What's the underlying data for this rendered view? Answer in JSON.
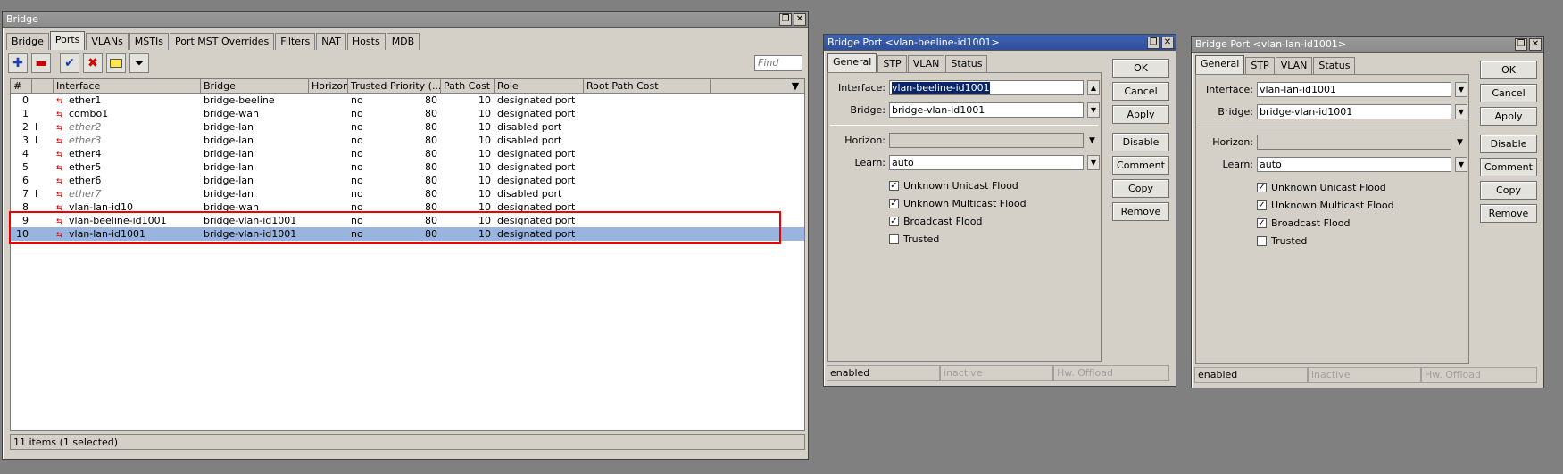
{
  "bridge_window": {
    "title": "Bridge",
    "tabs": [
      "Bridge",
      "Ports",
      "VLANs",
      "MSTIs",
      "Port MST Overrides",
      "Filters",
      "NAT",
      "Hosts",
      "MDB"
    ],
    "selected_tab": "Ports",
    "find_placeholder": "Find",
    "columns": [
      "#",
      "",
      "Interface",
      "Bridge",
      "Horizon",
      "Trusted",
      "Priority (...",
      "Path Cost",
      "Role",
      "Root Path Cost"
    ],
    "rows": [
      {
        "num": "0",
        "flag": "",
        "iface": "ether1",
        "bridge": "bridge-beeline",
        "horizon": "",
        "trusted": "no",
        "priority": "80",
        "cost": "10",
        "role": "designated port",
        "disabled": false
      },
      {
        "num": "1",
        "flag": "",
        "iface": "combo1",
        "bridge": "bridge-wan",
        "horizon": "",
        "trusted": "no",
        "priority": "80",
        "cost": "10",
        "role": "designated port",
        "disabled": false
      },
      {
        "num": "2",
        "flag": "I",
        "iface": "ether2",
        "bridge": "bridge-lan",
        "horizon": "",
        "trusted": "no",
        "priority": "80",
        "cost": "10",
        "role": "disabled port",
        "disabled": true
      },
      {
        "num": "3",
        "flag": "I",
        "iface": "ether3",
        "bridge": "bridge-lan",
        "horizon": "",
        "trusted": "no",
        "priority": "80",
        "cost": "10",
        "role": "disabled port",
        "disabled": true
      },
      {
        "num": "4",
        "flag": "",
        "iface": "ether4",
        "bridge": "bridge-lan",
        "horizon": "",
        "trusted": "no",
        "priority": "80",
        "cost": "10",
        "role": "designated port",
        "disabled": false
      },
      {
        "num": "5",
        "flag": "",
        "iface": "ether5",
        "bridge": "bridge-lan",
        "horizon": "",
        "trusted": "no",
        "priority": "80",
        "cost": "10",
        "role": "designated port",
        "disabled": false
      },
      {
        "num": "6",
        "flag": "",
        "iface": "ether6",
        "bridge": "bridge-lan",
        "horizon": "",
        "trusted": "no",
        "priority": "80",
        "cost": "10",
        "role": "designated port",
        "disabled": false
      },
      {
        "num": "7",
        "flag": "I",
        "iface": "ether7",
        "bridge": "bridge-lan",
        "horizon": "",
        "trusted": "no",
        "priority": "80",
        "cost": "10",
        "role": "disabled port",
        "disabled": true
      },
      {
        "num": "8",
        "flag": "",
        "iface": "vlan-lan-id10",
        "bridge": "bridge-wan",
        "horizon": "",
        "trusted": "no",
        "priority": "80",
        "cost": "10",
        "role": "designated port",
        "disabled": false
      },
      {
        "num": "9",
        "flag": "",
        "iface": "vlan-beeline-id1001",
        "bridge": "bridge-vlan-id1001",
        "horizon": "",
        "trusted": "no",
        "priority": "80",
        "cost": "10",
        "role": "designated port",
        "disabled": false
      },
      {
        "num": "10",
        "flag": "",
        "iface": "vlan-lan-id1001",
        "bridge": "bridge-vlan-id1001",
        "horizon": "",
        "trusted": "no",
        "priority": "80",
        "cost": "10",
        "role": "designated port",
        "disabled": false,
        "selected": true
      }
    ],
    "status": "11 items (1 selected)"
  },
  "dialog1": {
    "title": "Bridge Port <vlan-beeline-id1001>",
    "tabs": [
      "General",
      "STP",
      "VLAN",
      "Status"
    ],
    "interface_label": "Interface:",
    "interface_value": "vlan-beeline-id1001",
    "bridge_label": "Bridge:",
    "bridge_value": "bridge-vlan-id1001",
    "horizon_label": "Horizon:",
    "learn_label": "Learn:",
    "learn_value": "auto",
    "checks": [
      {
        "label": "Unknown Unicast Flood",
        "checked": true
      },
      {
        "label": "Unknown Multicast Flood",
        "checked": true
      },
      {
        "label": "Broadcast Flood",
        "checked": true
      },
      {
        "label": "Trusted",
        "checked": false
      }
    ],
    "buttons": [
      "OK",
      "Cancel",
      "Apply",
      "Disable",
      "Comment",
      "Copy",
      "Remove"
    ],
    "status": [
      "enabled",
      "inactive",
      "Hw. Offload"
    ]
  },
  "dialog2": {
    "title": "Bridge Port <vlan-lan-id1001>",
    "tabs": [
      "General",
      "STP",
      "VLAN",
      "Status"
    ],
    "interface_label": "Interface:",
    "interface_value": "vlan-lan-id1001",
    "bridge_label": "Bridge:",
    "bridge_value": "bridge-vlan-id1001",
    "horizon_label": "Horizon:",
    "learn_label": "Learn:",
    "learn_value": "auto",
    "checks": [
      {
        "label": "Unknown Unicast Flood",
        "checked": true
      },
      {
        "label": "Unknown Multicast Flood",
        "checked": true
      },
      {
        "label": "Broadcast Flood",
        "checked": true
      },
      {
        "label": "Trusted",
        "checked": false
      }
    ],
    "buttons": [
      "OK",
      "Cancel",
      "Apply",
      "Disable",
      "Comment",
      "Copy",
      "Remove"
    ],
    "status": [
      "enabled",
      "inactive",
      "Hw. Offload"
    ]
  },
  "title_buttons": {
    "restore": "❐",
    "close": "✕"
  },
  "colors": {
    "selection": "#99b4de",
    "highlight_box": "#e00000",
    "active_title": "#2f4f9c"
  }
}
